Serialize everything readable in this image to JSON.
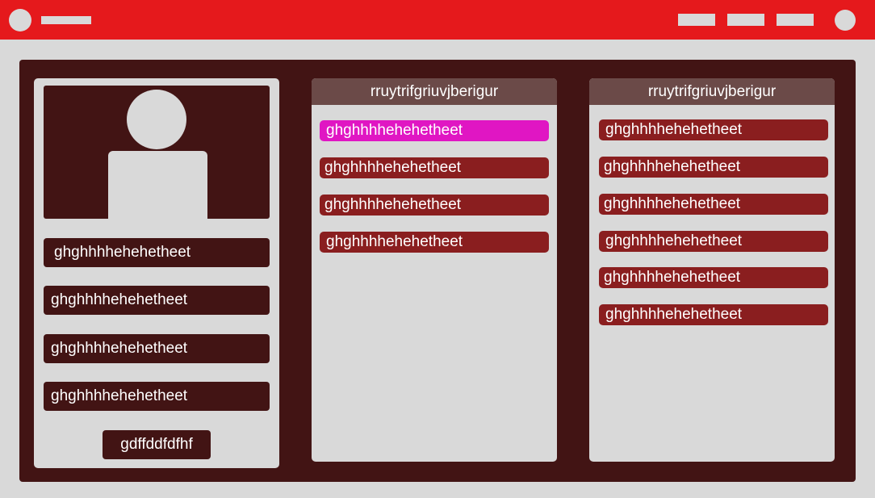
{
  "header": {
    "nav_items": [
      "",
      "",
      ""
    ]
  },
  "profile": {
    "fields": [
      "ghghhhhehehetheet",
      "ghghhhhehehetheet",
      "ghghhhhehehetheet",
      "ghghhhhehehetheet"
    ],
    "button_label": "gdffddfdfhf"
  },
  "lists": [
    {
      "title": "rruytrifgriuvjberigur",
      "active_index": 0,
      "items": [
        "ghghhhhehehetheet",
        "ghghhhhehehetheet",
        "ghghhhhehehetheet",
        "ghghhhhehehetheet"
      ]
    },
    {
      "title": "rruytrifgriuvjberigur",
      "active_index": null,
      "items": [
        "ghghhhhehehetheet",
        "ghghhhhehehetheet",
        "ghghhhhehehetheet",
        "ghghhhhehehetheet",
        "ghghhhhehehetheet",
        "ghghhhhehehetheet"
      ]
    }
  ],
  "colors": {
    "header_bg": "#e5191c",
    "panel_bg": "#421414",
    "card_bg": "#d9d9d9",
    "list_header_bg": "#6b4a48",
    "item_bg": "#8a1e1f",
    "item_active_bg": "#e016c3"
  }
}
